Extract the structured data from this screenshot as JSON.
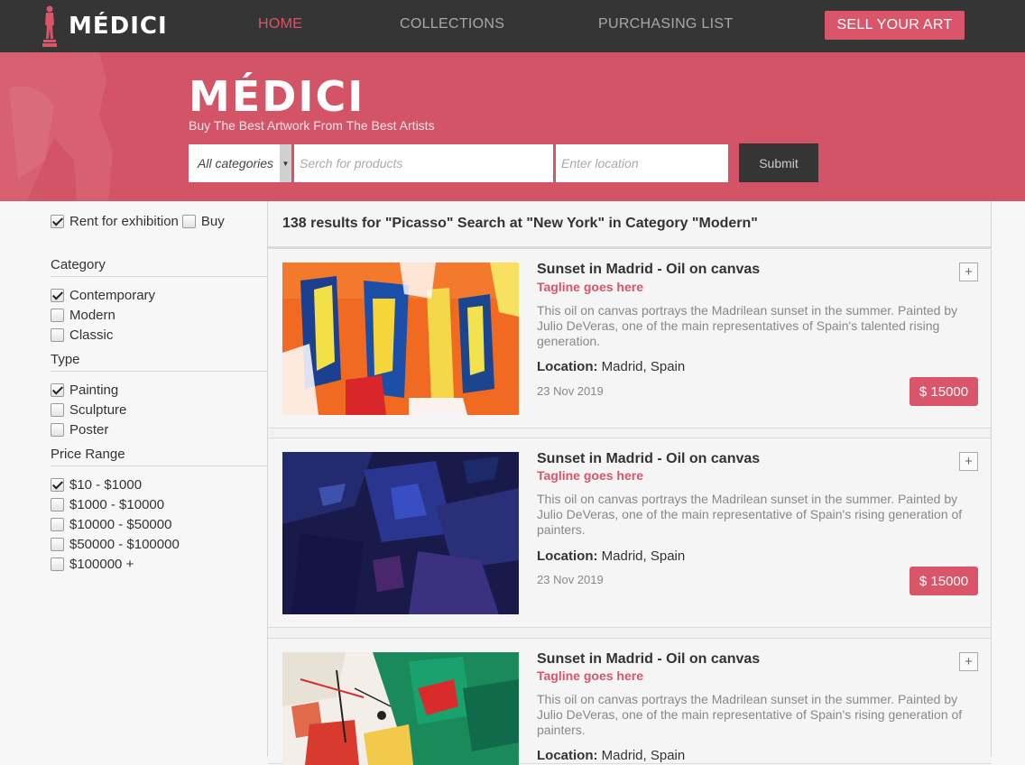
{
  "nav": {
    "brand": "MÉDICI",
    "links": [
      "HOME",
      "COLLECTIONS",
      "PURCHASING LIST"
    ],
    "sell_label": "SELL YOUR ART",
    "active_color": "#d9566a"
  },
  "hero": {
    "title": "MÉDICI",
    "subtitle": "Buy The Best Artwork From The Best Artists",
    "category_select": "All categories",
    "search_placeholder": "Serch for products",
    "location_placeholder": "Enter location",
    "submit_label": "Submit",
    "bg_color": "#d25466"
  },
  "filters": {
    "rent": {
      "label": "Rent for exhibition",
      "checked": true
    },
    "buy": {
      "label": "Buy",
      "checked": false
    },
    "category": {
      "title": "Category",
      "items": [
        {
          "label": "Contemporary",
          "checked": true
        },
        {
          "label": "Modern",
          "checked": false
        },
        {
          "label": "Classic",
          "checked": false
        }
      ]
    },
    "type": {
      "title": "Type",
      "items": [
        {
          "label": "Painting",
          "checked": true
        },
        {
          "label": "Sculpture",
          "checked": false
        },
        {
          "label": "Poster",
          "checked": false
        }
      ]
    },
    "price": {
      "title": "Price Range",
      "items": [
        {
          "label": "$10 - $1000",
          "checked": true
        },
        {
          "label": "$1000 - $10000",
          "checked": false
        },
        {
          "label": "$10000 - $50000",
          "checked": false
        },
        {
          "label": "$50000 - $100000",
          "checked": false
        },
        {
          "label": "$100000 +",
          "checked": false
        }
      ]
    }
  },
  "results": {
    "header": "138 results for \"Picasso\" Search at \"New York\" in Category \"Modern\"",
    "items": [
      {
        "title": "Sunset in Madrid - Oil on canvas",
        "tagline": "Tagline goes here",
        "description": "This oil on canvas portrays the Madrilean sunset in the summer. Painted by Julio DeVeras, one of the main representatives of Spain's talented rising generation.",
        "location_label": "Location:",
        "location": "Madrid, Spain",
        "date": "23 Nov 2019",
        "price": "$ 15000",
        "plus": "+"
      },
      {
        "title": "Sunset in Madrid - Oil on canvas",
        "tagline": "Tagline goes here",
        "description": "This oil on canvas portrays the Madrilean sunset in the summer. Painted by Julio DeVeras, one of the main representative of Spain's rising generation of painters.",
        "location_label": "Location:",
        "location": "Madrid, Spain",
        "date": "23 Nov 2019",
        "price": "$ 15000",
        "plus": "+"
      },
      {
        "title": "Sunset in Madrid - Oil on canvas",
        "tagline": "Tagline goes here",
        "description": "This oil on canvas portrays the Madrilean sunset in the summer. Painted by Julio DeVeras, one of the main representative of Spain's rising generation of painters.",
        "location_label": "Location:",
        "location": "Madrid, Spain",
        "plus": "+"
      }
    ]
  }
}
